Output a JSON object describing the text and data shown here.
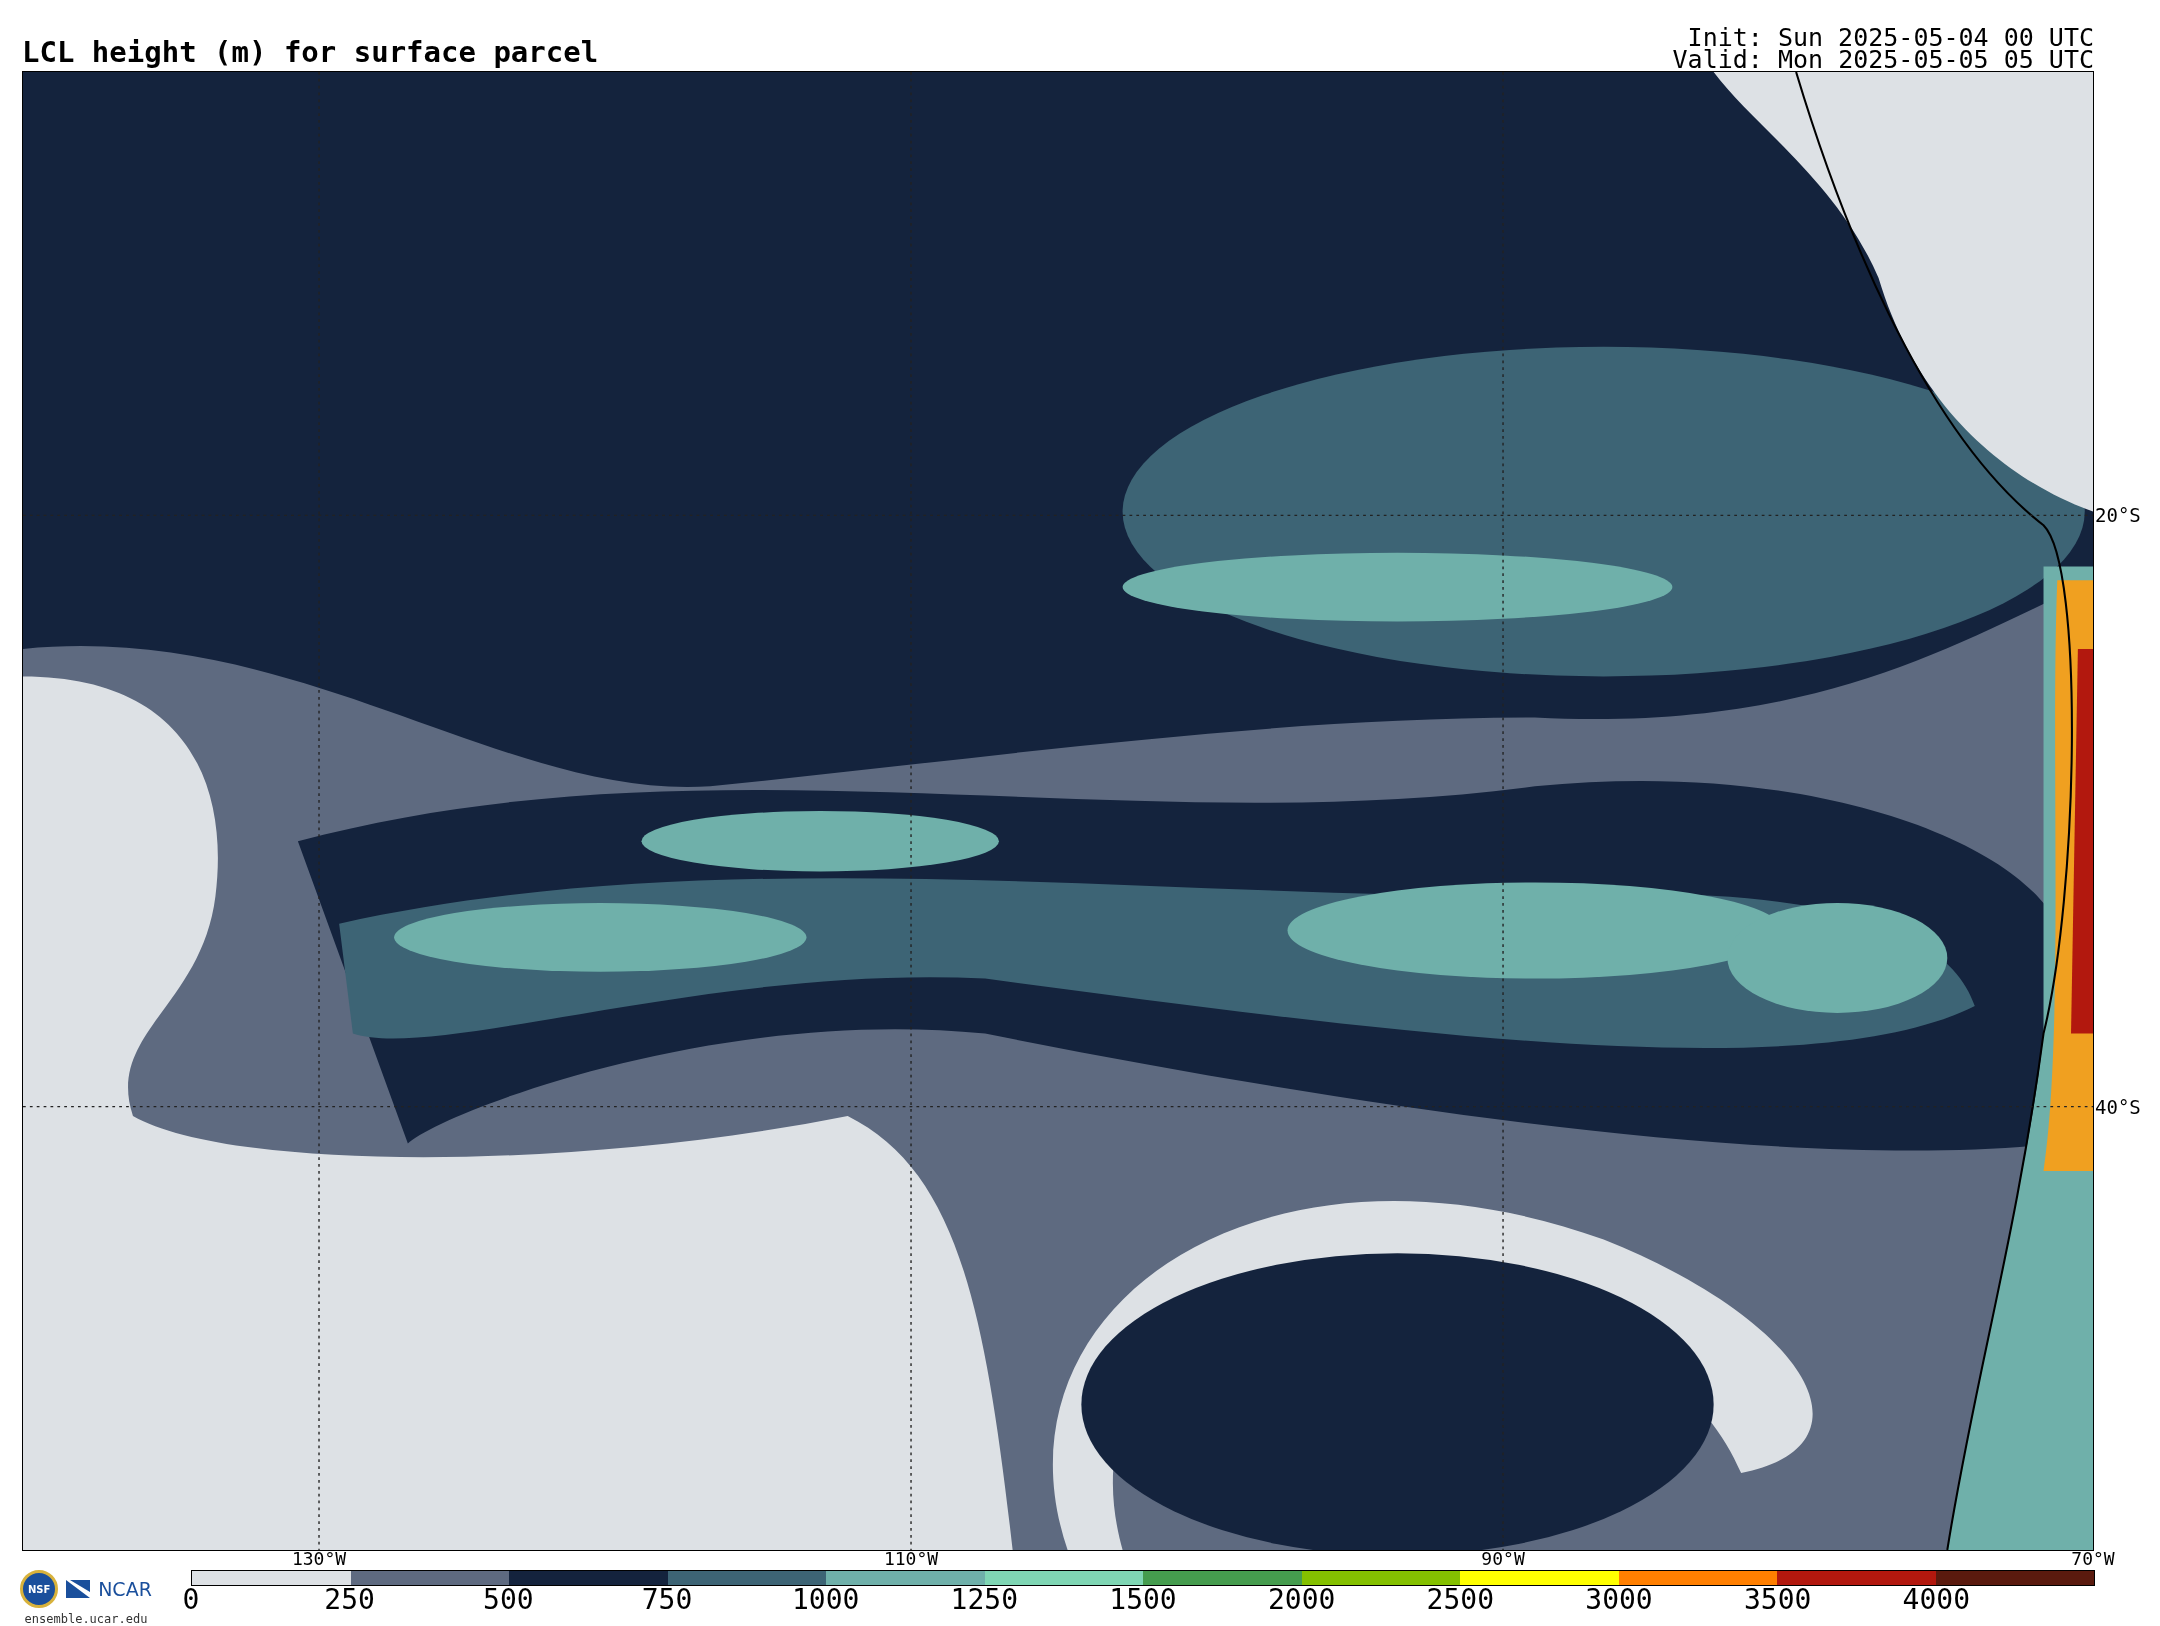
{
  "title": "LCL height (m) for surface parcel",
  "init": "Init: Sun 2025-05-04 00 UTC",
  "valid": "Valid: Mon 2025-05-05 05 UTC",
  "map": {
    "lat_labels": [
      "20°S",
      "40°S"
    ],
    "lon_labels": [
      "130°W",
      "110°W",
      "90°W",
      "70°W"
    ]
  },
  "logos": {
    "nsf": "NSF",
    "ncar": "NCAR",
    "site": "ensemble.ucar.edu"
  },
  "colorbar": {
    "segments": [
      {
        "color": "#dde1e5"
      },
      {
        "color": "#5e6a80"
      },
      {
        "color": "#14233d"
      },
      {
        "color": "#3d6475"
      },
      {
        "color": "#6fb0aa"
      },
      {
        "color": "#7fd6b4"
      },
      {
        "color": "#459c4e"
      },
      {
        "color": "#84c000"
      },
      {
        "color": "#ffff00"
      },
      {
        "color": "#ff7f00"
      },
      {
        "color": "#b2180e"
      },
      {
        "color": "#5a1a0e"
      }
    ],
    "ticks": [
      "0",
      "250",
      "500",
      "750",
      "1000",
      "1250",
      "1500",
      "2000",
      "2500",
      "3000",
      "3500",
      "4000"
    ]
  }
}
